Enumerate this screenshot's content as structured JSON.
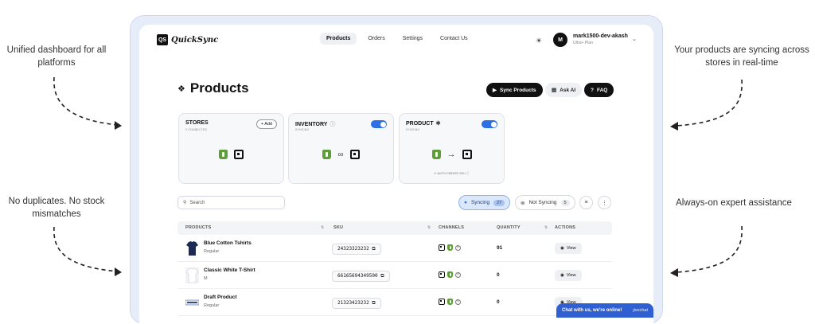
{
  "captions": {
    "top_left": "Unified dashboard for all platforms",
    "bottom_left": "No duplicates. No stock mismatches",
    "top_right": "Your products are syncing across stores in real-time",
    "bottom_right": "Always-on expert assistance"
  },
  "app": {
    "logo_mark": "QS",
    "logo_text": "QuickSync"
  },
  "nav": {
    "items": [
      "Products",
      "Orders",
      "Settings",
      "Contact Us"
    ],
    "active": "Products"
  },
  "user": {
    "initial": "M",
    "name": "mark1500-dev-akash",
    "plan": "Ultra+ Plan"
  },
  "page": {
    "title": "Products",
    "sync_button": "Sync Products",
    "ask_ai_button": "Ask AI",
    "faq_button": "FAQ"
  },
  "cards": {
    "stores": {
      "title": "STORES",
      "subtitle": "2 CONNECTED",
      "add_label": "+ Add"
    },
    "inventory": {
      "title": "INVENTORY",
      "subtitle": "SYNCING"
    },
    "product": {
      "title": "PRODUCT",
      "subtitle": "SYNCING",
      "note": "AUTO-CREATE SKU"
    }
  },
  "toolbar": {
    "search_placeholder": "Search",
    "syncing_label": "Syncing",
    "syncing_count": "27",
    "not_syncing_label": "Not Syncing",
    "not_syncing_count": "5"
  },
  "table": {
    "headers": [
      "PRODUCTS",
      "SKU",
      "CHANNELS",
      "QUANTITY",
      "ACTIONS"
    ],
    "rows": [
      {
        "name": "Blue Cotton Tshirts",
        "variant": "Regular",
        "sku": "24323323232",
        "quantity": "91",
        "action": "View"
      },
      {
        "name": "Classic White T-Shirt",
        "variant": "M",
        "sku": "66165694349500",
        "quantity": "0",
        "action": "View"
      },
      {
        "name": "Draft Product",
        "variant": "Regular",
        "sku": "21323423232",
        "quantity": "0",
        "action": "View"
      }
    ]
  },
  "chat": {
    "label": "Chat with us, we're online!",
    "brand": "jivochat"
  },
  "colors": {
    "accent": "#2f6fe4",
    "shopify": "#5e9e3a",
    "chat": "#2f5fd0"
  }
}
